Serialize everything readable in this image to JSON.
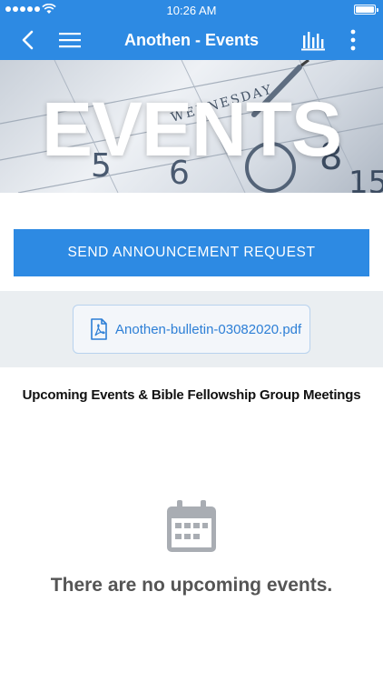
{
  "status_bar": {
    "time": "10:26 AM"
  },
  "nav_bar": {
    "title": "Anothen - Events"
  },
  "hero": {
    "title": "EVENTS",
    "background_text": [
      "WEDNESDAY",
      "5",
      "6",
      "8",
      "15"
    ]
  },
  "announcement": {
    "button_label": "SEND ANNOUNCEMENT REQUEST"
  },
  "attachment": {
    "file_name": "Anothen-bulletin-03082020.pdf",
    "icon": "pdf-icon"
  },
  "events": {
    "section_title": "Upcoming Events & Bible Fellowship Group Meetings",
    "empty_icon": "calendar-icon",
    "empty_message": "There are no upcoming events."
  },
  "colors": {
    "primary": "#2d8ae3",
    "band": "#eaeef1",
    "link": "#2d7fd6",
    "empty_text": "#555555",
    "empty_icon": "#a9adb3"
  }
}
